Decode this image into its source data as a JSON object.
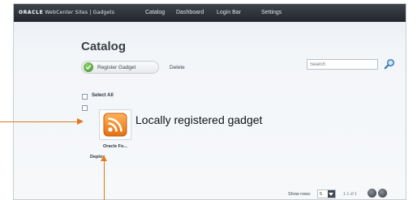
{
  "header": {
    "logo": "ORACLE",
    "product": "WebCenter Sites | Gadgets",
    "nav": {
      "catalog": "Catalog",
      "dashboard": "Dashboard",
      "login_bar": "Login Bar",
      "settings": "Settings"
    }
  },
  "page": {
    "title": "Catalog"
  },
  "toolbar": {
    "register_label": "Register Gadget",
    "delete_label": "Delete",
    "search_placeholder": "Search"
  },
  "list": {
    "select_all_label": "Select All",
    "items": [
      {
        "name": "Oracle Fo...",
        "action": "Deploy",
        "icon": "rss-feed-icon",
        "icon_color": "#f08a24"
      }
    ]
  },
  "footer": {
    "show_rows_label": "Show rows:",
    "rows_value": "5",
    "page_info": "1-1 of 1"
  },
  "annotation": {
    "text": "Locally registered gadget",
    "color": "#e07b1a"
  }
}
